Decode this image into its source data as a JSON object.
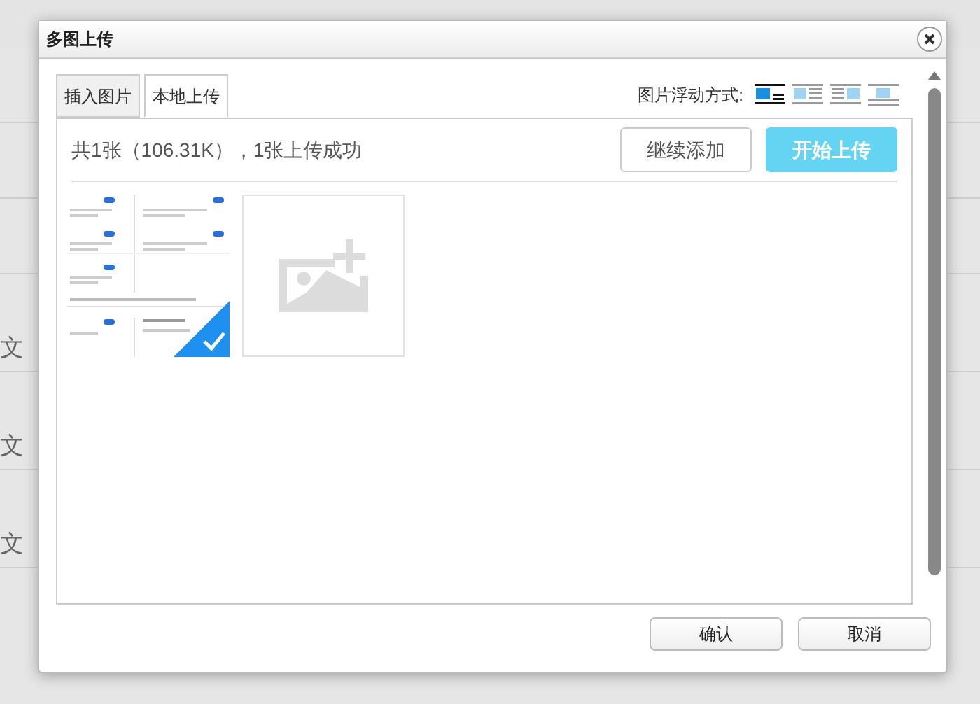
{
  "background": {
    "labels": [
      "文",
      "文",
      "文"
    ]
  },
  "dialog": {
    "title": "多图上传",
    "tabs": [
      {
        "label": "插入图片",
        "selected": false
      },
      {
        "label": "本地上传",
        "selected": true
      }
    ],
    "float_label": "图片浮动方式:",
    "float_modes": [
      {
        "kind": "none",
        "selected": true
      },
      {
        "kind": "left",
        "selected": false
      },
      {
        "kind": "right",
        "selected": false
      },
      {
        "kind": "center",
        "selected": false
      }
    ],
    "summary": "共1张（106.31K），1张上传成功",
    "add_button": "继续添加",
    "start_button": "开始上传",
    "images": [
      {
        "kind": "thumbnail",
        "selected": true
      },
      {
        "kind": "add",
        "selected": false
      }
    ],
    "buttons": [
      "确认",
      "取消"
    ]
  }
}
